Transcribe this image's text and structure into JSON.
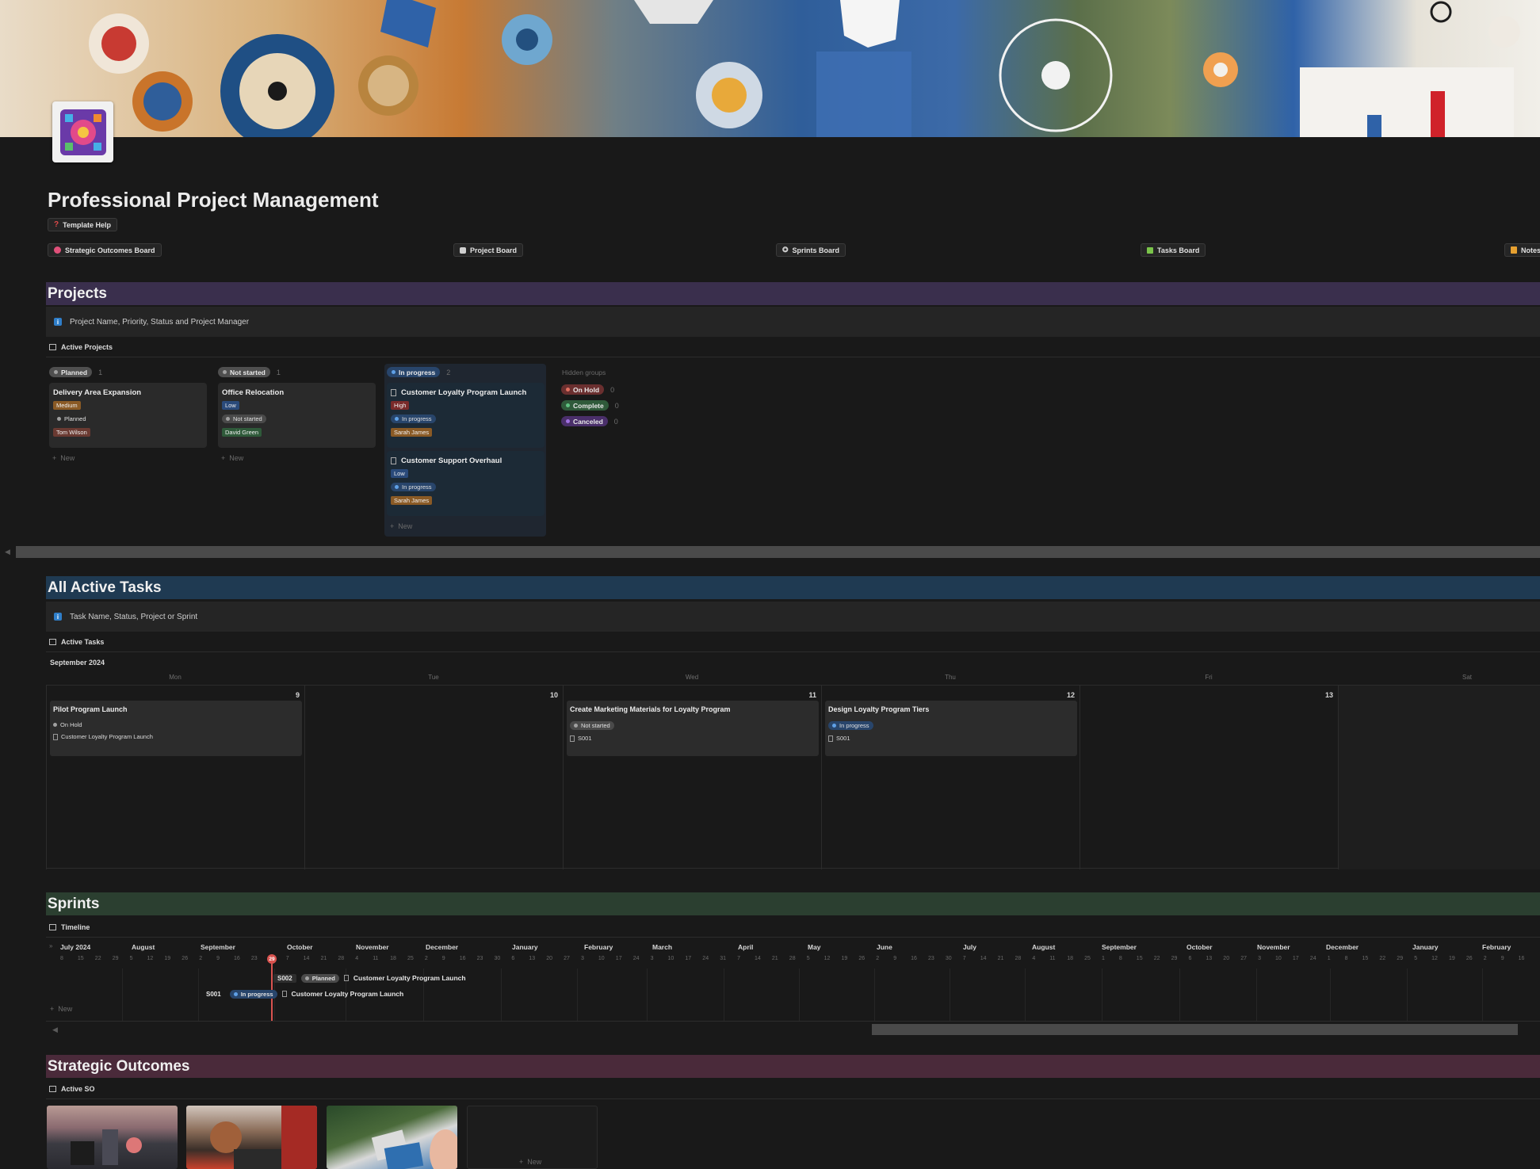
{
  "page": {
    "title": "Professional Project Management",
    "help_chip": "Template Help"
  },
  "nav": [
    {
      "label": "Strategic Outcomes Board",
      "icon": "target-icon",
      "color": "#e0507a"
    },
    {
      "label": "Project Board",
      "icon": "checkbox-icon",
      "color": "#d0d0d0"
    },
    {
      "label": "Sprints Board",
      "icon": "runner-icon",
      "color": "#d0d0d0"
    },
    {
      "label": "Tasks Board",
      "icon": "checklist-icon",
      "color": "#7ac44a"
    },
    {
      "label": "Notes",
      "icon": "notebook-icon",
      "color": "#e6a030"
    }
  ],
  "projects": {
    "heading": "Projects",
    "heading_bg": "#3a2f4d",
    "callout": "Project Name, Priority, Status and Project Manager",
    "view": "Active Projects",
    "columns": [
      {
        "label": "Planned",
        "count": "1",
        "color": "#5a5a5a",
        "dot": "#a0a0a0"
      },
      {
        "label": "Not started",
        "count": "1",
        "color": "#5a5a5a",
        "dot": "#a0a0a0"
      },
      {
        "label": "In progress",
        "count": "2",
        "color": "#28456b",
        "dot": "#5fa0e6"
      }
    ],
    "cards": [
      {
        "title": "Delivery Area Expansion",
        "priority": "Medium",
        "priority_color": "#8a5a25",
        "status": "Planned",
        "manager": "Tom Wilson",
        "manager_color": "#6a3a32"
      },
      {
        "title": "Office Relocation",
        "priority": "Low",
        "priority_color": "#2a4a7a",
        "status": "Not started",
        "manager": "David Green",
        "manager_color": "#2f5a3a"
      },
      {
        "title": "Customer Loyalty Program Launch",
        "priority": "High",
        "priority_color": "#7a2a2a",
        "status": "In progress",
        "manager": "Sarah James",
        "manager_color": "#8a5a25"
      },
      {
        "title": "Customer Support Overhaul",
        "priority": "Low",
        "priority_color": "#2a4a7a",
        "status": "In progress",
        "manager": "Sarah James",
        "manager_color": "#8a5a25"
      }
    ],
    "new_label": "New",
    "hidden_groups_label": "Hidden groups",
    "hidden_groups": [
      {
        "label": "On Hold",
        "count": "0",
        "color": "#6a2f2f",
        "dot": "#e07060"
      },
      {
        "label": "Complete",
        "count": "0",
        "color": "#2f5a3a",
        "dot": "#60c080"
      },
      {
        "label": "Canceled",
        "count": "0",
        "color": "#4a2f6a",
        "dot": "#a070e0"
      }
    ]
  },
  "tasks": {
    "heading": "All Active Tasks",
    "heading_bg": "#1f3a52",
    "callout": "Task Name, Status, Project or Sprint",
    "view": "Active Tasks",
    "month": "September 2024",
    "days_of_week": [
      "Mon",
      "Tue",
      "Wed",
      "Thu",
      "Fri",
      "Sat"
    ],
    "day_numbers": [
      "9",
      "10",
      "11",
      "12",
      "13",
      ""
    ],
    "items": [
      {
        "title": "Pilot Program Launch",
        "status": "On Hold",
        "status_dot": "#a0a0a0",
        "status_bg": "transparent",
        "ref": "Customer Loyalty Program Launch"
      },
      {
        "title": "Create Marketing Materials for Loyalty Program",
        "status": "Not started",
        "status_dot": "#a0a0a0",
        "status_bg": "#4a4a4a",
        "ref": "S001"
      },
      {
        "title": "Design Loyalty Program Tiers",
        "status": "In progress",
        "status_dot": "#5fa0e6",
        "status_bg": "#28456b",
        "ref": "S001"
      }
    ]
  },
  "sprints": {
    "heading": "Sprints",
    "heading_bg": "#2b3f30",
    "view": "Timeline",
    "months": [
      "July 2024",
      "August",
      "September",
      "October",
      "November",
      "December",
      "January",
      "February",
      "March",
      "April",
      "May",
      "June",
      "July",
      "August",
      "September",
      "October",
      "November",
      "December",
      "January",
      "February"
    ],
    "days": [
      "8",
      "15",
      "22",
      "29",
      "5",
      "12",
      "19",
      "26",
      "2",
      "9",
      "16",
      "23",
      "29",
      "7",
      "14",
      "21",
      "28",
      "4",
      "11",
      "18",
      "25",
      "2",
      "9",
      "16",
      "23",
      "30",
      "6",
      "13",
      "20",
      "27",
      "3",
      "10",
      "17",
      "24",
      "3",
      "10",
      "17",
      "24",
      "31",
      "7",
      "14",
      "21",
      "28",
      "5",
      "12",
      "19",
      "26",
      "2",
      "9",
      "16",
      "23",
      "30",
      "7",
      "14",
      "21",
      "28",
      "4",
      "11",
      "18",
      "25",
      "1",
      "8",
      "15",
      "22",
      "29",
      "6",
      "13",
      "20",
      "27",
      "3",
      "10",
      "17",
      "24",
      "1",
      "8",
      "15",
      "22",
      "29",
      "5",
      "12",
      "19",
      "26",
      "2",
      "9",
      "16",
      "23"
    ],
    "today": "29",
    "bars": [
      {
        "id": "S002",
        "status": "Planned",
        "status_dot": "#a0a0a0",
        "status_bg": "#4a4a4a",
        "title": "Customer Loyalty Program Launch"
      },
      {
        "id": "S001",
        "status": "In progress",
        "status_dot": "#5fa0e6",
        "status_bg": "#28456b",
        "title": "Customer Loyalty Program Launch"
      }
    ],
    "new_label": "New"
  },
  "outcomes": {
    "heading": "Strategic Outcomes",
    "heading_bg": "#4a2a3a",
    "view": "Active SO",
    "new_label": "New"
  }
}
